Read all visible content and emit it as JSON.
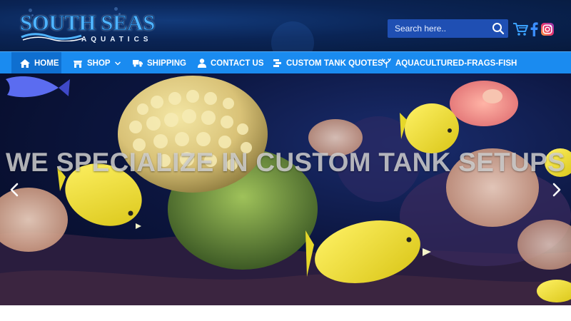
{
  "header": {
    "logo_text": "SOUTH SEAS",
    "logo_subtext": "AQUATICS",
    "search": {
      "placeholder": "Search here.."
    }
  },
  "nav": {
    "items": [
      {
        "label": "HOME",
        "icon": "home-icon"
      },
      {
        "label": "SHOP",
        "icon": "shop-icon"
      },
      {
        "label": "SHIPPING",
        "icon": "truck-icon"
      },
      {
        "label": "CONTACT US",
        "icon": "user-icon"
      },
      {
        "label": "CUSTOM TANK QUOTES",
        "icon": "quote-icon"
      },
      {
        "label": "AQUACULTURED-FRAGS-FISH",
        "icon": "coral-icon"
      }
    ]
  },
  "hero": {
    "title": "WE SPECIALIZE IN CUSTOM TANK SETUPS"
  },
  "colors": {
    "header_bg": "#0a2455",
    "nav_bg": "#1a8bf0",
    "nav_active": "#0f6fd0",
    "search_bg": "#1f4fb3"
  }
}
